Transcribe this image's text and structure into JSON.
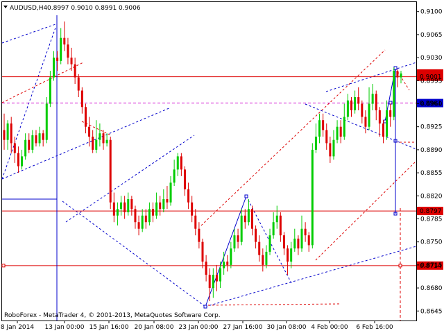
{
  "header": {
    "symbol_tf": "AUDUSD,H4",
    "ohlc": "0.8997 0.9010 0.8991 0.9006"
  },
  "footer": {
    "copyright": "RoboForex - MetaTrader 4, © 2001-2013, MetaQuotes Software Corp."
  },
  "colors": {
    "bull": "#00cc00",
    "bear": "#dd0000",
    "level": "#dd0000",
    "trend_blue": "#0000cc",
    "trend_red": "#dd0000",
    "grid": "#000000"
  },
  "chart_data": {
    "type": "candlestick",
    "ylim": [
      0.863,
      0.9115
    ],
    "y_ticks": [
      "0.9100",
      "0.9065",
      "0.9030",
      "0.8995",
      "0.8960",
      "0.8925",
      "0.8890",
      "0.8855",
      "0.8820",
      "0.8785",
      "0.8750",
      "0.8715",
      "0.8680",
      "0.8645"
    ],
    "x_ticks": [
      "8 Jan 2014",
      "13 Jan 00:00",
      "15 Jan 16:00",
      "20 Jan 08:00",
      "23 Jan 00:00",
      "27 Jan 16:00",
      "30 Jan 08:00",
      "4 Feb 00:00",
      "6 Feb 16:00"
    ],
    "price_labels": [
      "0.9001",
      "0.8961",
      "0.8797",
      "0.8714"
    ],
    "current_price": "0.9006",
    "candles": [
      [
        0.892,
        0.8905,
        0.8945,
        0.889
      ],
      [
        0.8905,
        0.893,
        0.8935,
        0.889
      ],
      [
        0.893,
        0.89,
        0.894,
        0.8885
      ],
      [
        0.89,
        0.8885,
        0.891,
        0.887
      ],
      [
        0.8885,
        0.8865,
        0.8895,
        0.8855
      ],
      [
        0.8865,
        0.888,
        0.889,
        0.886
      ],
      [
        0.888,
        0.8905,
        0.8915,
        0.8875
      ],
      [
        0.8905,
        0.889,
        0.8915,
        0.8885
      ],
      [
        0.889,
        0.8912,
        0.892,
        0.8885
      ],
      [
        0.8912,
        0.89,
        0.892,
        0.8895
      ],
      [
        0.89,
        0.8915,
        0.8925,
        0.8895
      ],
      [
        0.8915,
        0.8905,
        0.892,
        0.8895
      ],
      [
        0.8905,
        0.896,
        0.897,
        0.89
      ],
      [
        0.896,
        0.9,
        0.901,
        0.8955
      ],
      [
        0.9,
        0.903,
        0.904,
        0.8995
      ],
      [
        0.903,
        0.9025,
        0.904,
        0.901
      ],
      [
        0.9025,
        0.906,
        0.9075,
        0.902
      ],
      [
        0.906,
        0.905,
        0.9085,
        0.904
      ],
      [
        0.905,
        0.903,
        0.906,
        0.902
      ],
      [
        0.903,
        0.902,
        0.9045,
        0.901
      ],
      [
        0.902,
        0.9,
        0.903,
        0.899
      ],
      [
        0.9,
        0.898,
        0.9005,
        0.897
      ],
      [
        0.898,
        0.8955,
        0.8985,
        0.8945
      ],
      [
        0.8955,
        0.8925,
        0.896,
        0.8915
      ],
      [
        0.8925,
        0.891,
        0.894,
        0.8895
      ],
      [
        0.891,
        0.889,
        0.892,
        0.8885
      ],
      [
        0.889,
        0.8905,
        0.8935,
        0.8885
      ],
      [
        0.8905,
        0.8915,
        0.893,
        0.8895
      ],
      [
        0.8915,
        0.89,
        0.892,
        0.889
      ],
      [
        0.89,
        0.8905,
        0.8915,
        0.8895
      ],
      [
        0.8905,
        0.881,
        0.891,
        0.88
      ],
      [
        0.881,
        0.879,
        0.8825,
        0.878
      ],
      [
        0.879,
        0.88,
        0.881,
        0.8775
      ],
      [
        0.88,
        0.881,
        0.882,
        0.879
      ],
      [
        0.881,
        0.8795,
        0.882,
        0.8785
      ],
      [
        0.8795,
        0.8815,
        0.8825,
        0.879
      ],
      [
        0.8815,
        0.88,
        0.882,
        0.879
      ],
      [
        0.88,
        0.878,
        0.8805,
        0.877
      ],
      [
        0.878,
        0.877,
        0.879,
        0.876
      ],
      [
        0.877,
        0.879,
        0.88,
        0.8765
      ],
      [
        0.879,
        0.878,
        0.88,
        0.877
      ],
      [
        0.878,
        0.88,
        0.881,
        0.8775
      ],
      [
        0.88,
        0.879,
        0.881,
        0.878
      ],
      [
        0.879,
        0.881,
        0.8825,
        0.8785
      ],
      [
        0.881,
        0.88,
        0.882,
        0.879
      ],
      [
        0.88,
        0.8815,
        0.883,
        0.8795
      ],
      [
        0.8815,
        0.881,
        0.8835,
        0.88
      ],
      [
        0.881,
        0.884,
        0.885,
        0.8805
      ],
      [
        0.884,
        0.886,
        0.8875,
        0.8835
      ],
      [
        0.886,
        0.888,
        0.8885,
        0.885
      ],
      [
        0.888,
        0.886,
        0.8885,
        0.885
      ],
      [
        0.886,
        0.883,
        0.8865,
        0.882
      ],
      [
        0.883,
        0.881,
        0.884,
        0.88
      ],
      [
        0.881,
        0.879,
        0.882,
        0.878
      ],
      [
        0.879,
        0.877,
        0.88,
        0.876
      ],
      [
        0.877,
        0.875,
        0.878,
        0.874
      ],
      [
        0.875,
        0.872,
        0.8755,
        0.871
      ],
      [
        0.872,
        0.87,
        0.873,
        0.869
      ],
      [
        0.87,
        0.868,
        0.871,
        0.866
      ],
      [
        0.868,
        0.87,
        0.871,
        0.8665
      ],
      [
        0.87,
        0.869,
        0.8715,
        0.8675
      ],
      [
        0.869,
        0.871,
        0.872,
        0.868
      ],
      [
        0.871,
        0.872,
        0.8735,
        0.87
      ],
      [
        0.872,
        0.8715,
        0.873,
        0.8705
      ],
      [
        0.8715,
        0.874,
        0.875,
        0.871
      ],
      [
        0.874,
        0.876,
        0.877,
        0.8735
      ],
      [
        0.876,
        0.875,
        0.877,
        0.874
      ],
      [
        0.875,
        0.879,
        0.88,
        0.8745
      ],
      [
        0.879,
        0.878,
        0.88,
        0.877
      ],
      [
        0.878,
        0.88,
        0.8815,
        0.8775
      ],
      [
        0.88,
        0.877,
        0.8805,
        0.876
      ],
      [
        0.877,
        0.875,
        0.8775,
        0.874
      ],
      [
        0.875,
        0.873,
        0.876,
        0.872
      ],
      [
        0.873,
        0.8715,
        0.874,
        0.8705
      ],
      [
        0.8715,
        0.8735,
        0.8745,
        0.871
      ],
      [
        0.8735,
        0.876,
        0.877,
        0.873
      ],
      [
        0.876,
        0.878,
        0.8795,
        0.8755
      ],
      [
        0.878,
        0.879,
        0.8805,
        0.877
      ],
      [
        0.879,
        0.876,
        0.8795,
        0.875
      ],
      [
        0.876,
        0.874,
        0.8765,
        0.873
      ],
      [
        0.874,
        0.872,
        0.8745,
        0.87
      ],
      [
        0.872,
        0.874,
        0.875,
        0.871
      ],
      [
        0.874,
        0.8755,
        0.877,
        0.8735
      ],
      [
        0.8755,
        0.874,
        0.876,
        0.873
      ],
      [
        0.874,
        0.877,
        0.879,
        0.8735
      ],
      [
        0.877,
        0.876,
        0.878,
        0.875
      ],
      [
        0.876,
        0.8745,
        0.8765,
        0.8735
      ],
      [
        0.8745,
        0.889,
        0.89,
        0.874
      ],
      [
        0.889,
        0.891,
        0.893,
        0.8885
      ],
      [
        0.891,
        0.8935,
        0.8945,
        0.89
      ],
      [
        0.8935,
        0.892,
        0.8945,
        0.891
      ],
      [
        0.892,
        0.89,
        0.893,
        0.889
      ],
      [
        0.89,
        0.888,
        0.891,
        0.887
      ],
      [
        0.888,
        0.8905,
        0.892,
        0.8875
      ],
      [
        0.8905,
        0.8925,
        0.8935,
        0.89
      ],
      [
        0.8925,
        0.891,
        0.8935,
        0.89
      ],
      [
        0.891,
        0.894,
        0.896,
        0.8905
      ],
      [
        0.894,
        0.8965,
        0.8975,
        0.8935
      ],
      [
        0.8965,
        0.895,
        0.897,
        0.894
      ],
      [
        0.895,
        0.897,
        0.898,
        0.8945
      ],
      [
        0.897,
        0.896,
        0.8985,
        0.895
      ],
      [
        0.896,
        0.894,
        0.8965,
        0.893
      ],
      [
        0.894,
        0.8925,
        0.895,
        0.8915
      ],
      [
        0.8925,
        0.896,
        0.8985,
        0.892
      ],
      [
        0.896,
        0.8975,
        0.899,
        0.895
      ],
      [
        0.8975,
        0.895,
        0.898,
        0.8935
      ],
      [
        0.895,
        0.893,
        0.8955,
        0.891
      ],
      [
        0.893,
        0.891,
        0.8935,
        0.89
      ],
      [
        0.891,
        0.895,
        0.8965,
        0.8905
      ],
      [
        0.895,
        0.894,
        0.896,
        0.8925
      ],
      [
        0.894,
        0.901,
        0.9015,
        0.8935
      ],
      [
        0.901,
        0.9,
        0.9012,
        0.8985
      ],
      [
        0.9,
        0.9006,
        0.901,
        0.8991
      ]
    ],
    "annotations": [
      "RoboForex - MetaTrader 4, © 2001-2013, MetaQuotes Software Corp."
    ]
  }
}
